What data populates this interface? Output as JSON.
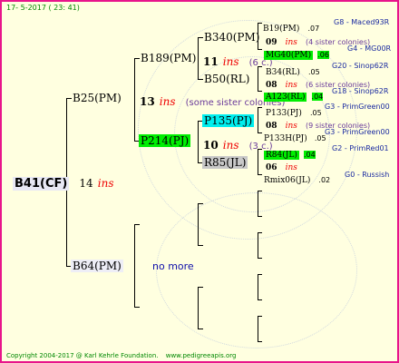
{
  "header": {
    "date": "17-  5-2017 ( 23: 41)"
  },
  "footer": {
    "copyright": "Copyright 2004-2017 @ Karl Kehrle Foundation.",
    "site": "www.pedigreeapis.org"
  },
  "colors": {
    "border": "#e8158b",
    "background": "#ffffe0",
    "green_box": "#00ee00",
    "cyan_box": "#00eeee",
    "grey_box": "#c8c8c8",
    "insemination": "#ee0000",
    "source": "#1a2aa0"
  },
  "root": {
    "label": "B41(CF)",
    "generation": "14",
    "ins": "ins"
  },
  "gen1": {
    "upper": {
      "label": "B25(PM)",
      "generation": "13",
      "ins": "ins",
      "sisters": "(some sister colonies)"
    },
    "lower": {
      "label": "B64(PM)",
      "note": "no more"
    }
  },
  "gen2": {
    "upper": {
      "label": "B189(PM)"
    },
    "lower": {
      "label": "P214(PJ)",
      "generation": "10",
      "ins": "ins",
      "sisters": "(3 c.)"
    }
  },
  "gen3": {
    "a": {
      "label": "B340(PM)",
      "generation": "11",
      "ins": "ins",
      "sisters": "(6 c.)"
    },
    "b": {
      "label": "B50(RL)"
    },
    "c": {
      "label": "P135(PJ)"
    },
    "d": {
      "label": "R85(JL)"
    }
  },
  "gen4": [
    {
      "label": "B19(PM)",
      "value": ".07",
      "source": "G8 - Maced93R"
    },
    {
      "generation": "09",
      "ins": "ins",
      "sisters": "(4 sister colonies)"
    },
    {
      "label": "MG40(PM)",
      "value": ".06",
      "source": "G4 - MG00R"
    },
    {
      "label": "B34(RL)",
      "value": ".05",
      "source": "G20 - Sinop62R"
    },
    {
      "generation": "08",
      "ins": "ins",
      "sisters": "(6 sister colonies)"
    },
    {
      "label": "A123(RL)",
      "value": ".04",
      "source": "G18 - Sinop62R"
    },
    {
      "label": "P133(PJ)",
      "value": ".05",
      "source": "G3 - PrimGreen00"
    },
    {
      "generation": "08",
      "ins": "ins",
      "sisters": "(9 sister colonies)"
    },
    {
      "label": "P133H(PJ)",
      "value": ".05",
      "source": "G3 - PrimGreen00"
    },
    {
      "label": "R84(JL)",
      "value": ".04",
      "source": "G2 - PrimRed01"
    },
    {
      "generation": "06",
      "ins": "ins"
    },
    {
      "label": "Rmix06(JL)",
      "value": ".02",
      "source": "G0 - Russish"
    }
  ]
}
